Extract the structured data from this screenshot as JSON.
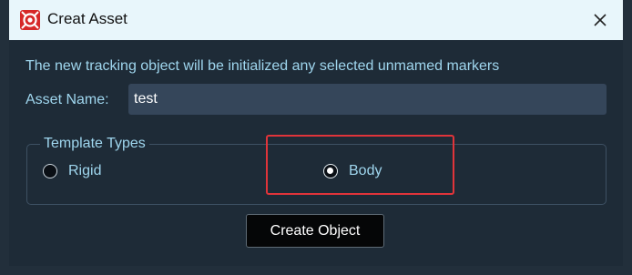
{
  "window": {
    "title": "Creat Asset",
    "app_icon": "app-logo-icon",
    "close_icon": "close-icon"
  },
  "dialog": {
    "info_text": "The new tracking object will be initialized any selected unmamed markers",
    "asset_name_label": "Asset Name:",
    "asset_name_value": "test"
  },
  "template_types": {
    "legend": "Template Types",
    "options": [
      {
        "label": "Rigid",
        "selected": false
      },
      {
        "label": "Body",
        "selected": true
      }
    ]
  },
  "actions": {
    "create_label": "Create Object"
  },
  "colors": {
    "accent_text": "#9fd6ee",
    "highlight_annotation": "#e0343a",
    "titlebar": "#e8f6fb",
    "background": "#1e2b37"
  }
}
